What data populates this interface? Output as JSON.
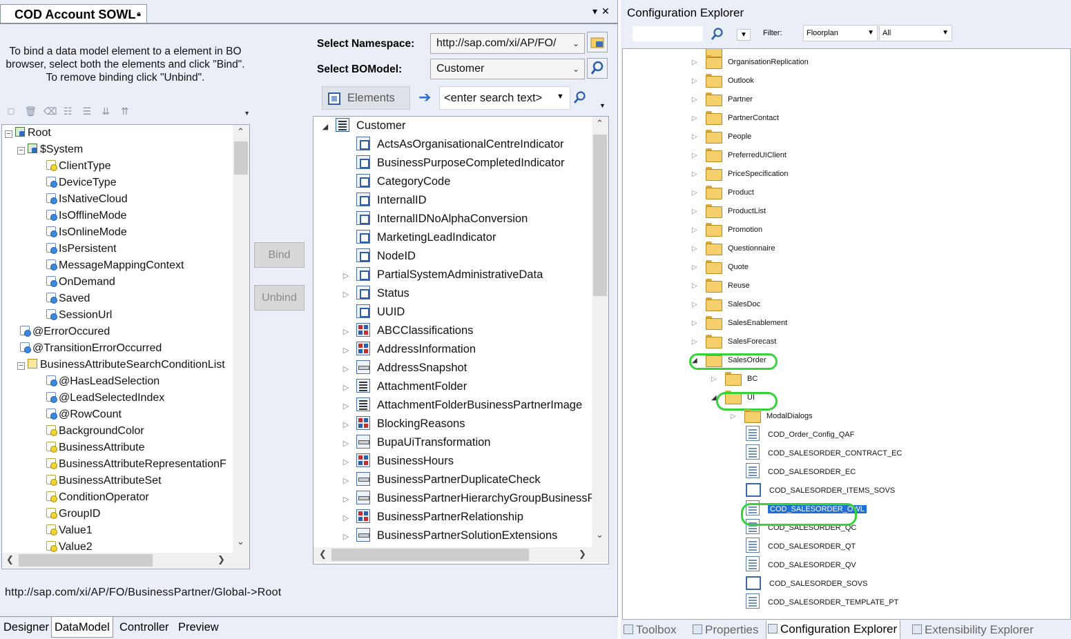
{
  "left_pane": {
    "tab_title": "COD Account SOWL",
    "instructions": "To bind a data model element to a element in BO browser, select both the elements and click \"Bind\". To remove binding click \"Unbind\".",
    "namespace_label": "Select Namespace:",
    "namespace_value": "http://sap.com/xi/AP/FO/",
    "bomodel_label": "Select BOModel:",
    "bomodel_value": "Customer",
    "bind_label": "Bind",
    "unbind_label": "Unbind",
    "elements_label": "Elements",
    "search_placeholder": "<enter search text>",
    "path_text": "http://sap.com/xi/AP/FO/BusinessPartner/Global->Root",
    "bottom_tabs": [
      "Designer",
      "DataModel",
      "Controller",
      "Preview"
    ],
    "active_bottom_tab": "DataModel",
    "datamodel_tree": [
      {
        "label": "Root",
        "level": 0,
        "icon": "root",
        "expander": "-"
      },
      {
        "label": "$System",
        "level": 1,
        "icon": "root",
        "expander": "-"
      },
      {
        "label": "ClientType",
        "level": 2,
        "icon": "attr-y"
      },
      {
        "label": "DeviceType",
        "level": 2,
        "icon": "attr-b"
      },
      {
        "label": "IsNativeCloud",
        "level": 2,
        "icon": "attr-b"
      },
      {
        "label": "IsOfflineMode",
        "level": 2,
        "icon": "attr-b"
      },
      {
        "label": "IsOnlineMode",
        "level": 2,
        "icon": "attr-b"
      },
      {
        "label": "IsPersistent",
        "level": 2,
        "icon": "attr-b"
      },
      {
        "label": "MessageMappingContext",
        "level": 2,
        "icon": "attr-b"
      },
      {
        "label": "OnDemand",
        "level": 2,
        "icon": "attr-b"
      },
      {
        "label": "Saved",
        "level": 2,
        "icon": "attr-b"
      },
      {
        "label": "SessionUrl",
        "level": 2,
        "icon": "attr-b"
      },
      {
        "label": "@ErrorOccured",
        "level": 1,
        "icon": "attr-b"
      },
      {
        "label": "@TransitionErrorOccurred",
        "level": 1,
        "icon": "attr-b"
      },
      {
        "label": "BusinessAttributeSearchConditionList",
        "level": 1,
        "icon": "list",
        "expander": "-"
      },
      {
        "label": "@HasLeadSelection",
        "level": 2,
        "icon": "attr-b"
      },
      {
        "label": "@LeadSelectedIndex",
        "level": 2,
        "icon": "attr-b"
      },
      {
        "label": "@RowCount",
        "level": 2,
        "icon": "attr-b"
      },
      {
        "label": "BackgroundColor",
        "level": 2,
        "icon": "attr-y"
      },
      {
        "label": "BusinessAttribute",
        "level": 2,
        "icon": "attr-y"
      },
      {
        "label": "BusinessAttributeRepresentationF",
        "level": 2,
        "icon": "attr-y"
      },
      {
        "label": "BusinessAttributeSet",
        "level": 2,
        "icon": "attr-y"
      },
      {
        "label": "ConditionOperator",
        "level": 2,
        "icon": "attr-y"
      },
      {
        "label": "GroupID",
        "level": 2,
        "icon": "attr-y"
      },
      {
        "label": "Value1",
        "level": 2,
        "icon": "attr-y"
      },
      {
        "label": "Value2",
        "level": 2,
        "icon": "attr-y"
      }
    ],
    "bo_tree_root": "Customer",
    "bo_tree": [
      {
        "label": "ActsAsOrganisationalCentreIndicator",
        "icon": "attr",
        "expandable": false
      },
      {
        "label": "BusinessPurposeCompletedIndicator",
        "icon": "attr",
        "expandable": false
      },
      {
        "label": "CategoryCode",
        "icon": "attr",
        "expandable": false
      },
      {
        "label": "InternalID",
        "icon": "attr",
        "expandable": false
      },
      {
        "label": "InternalIDNoAlphaConversion",
        "icon": "attr",
        "expandable": false
      },
      {
        "label": "MarketingLeadIndicator",
        "icon": "attr",
        "expandable": false
      },
      {
        "label": "NodeID",
        "icon": "attr",
        "expandable": false
      },
      {
        "label": "PartialSystemAdministrativeData",
        "icon": "attr",
        "expandable": true
      },
      {
        "label": "Status",
        "icon": "attr",
        "expandable": true
      },
      {
        "label": "UUID",
        "icon": "attr",
        "expandable": false
      },
      {
        "label": "ABCClassifications",
        "icon": "assoc-red",
        "expandable": true
      },
      {
        "label": "AddressInformation",
        "icon": "assoc-red",
        "expandable": true
      },
      {
        "label": "AddressSnapshot",
        "icon": "assoc",
        "expandable": true
      },
      {
        "label": "AttachmentFolder",
        "icon": "list",
        "expandable": true
      },
      {
        "label": "AttachmentFolderBusinessPartnerImage",
        "icon": "list",
        "expandable": true
      },
      {
        "label": "BlockingReasons",
        "icon": "assoc-red",
        "expandable": true
      },
      {
        "label": "BupaUiTransformation",
        "icon": "assoc",
        "expandable": true
      },
      {
        "label": "BusinessHours",
        "icon": "assoc-red",
        "expandable": true
      },
      {
        "label": "BusinessPartnerDuplicateCheck",
        "icon": "assoc",
        "expandable": true
      },
      {
        "label": "BusinessPartnerHierarchyGroupBusinessPa",
        "icon": "assoc",
        "expandable": true
      },
      {
        "label": "BusinessPartnerRelationship",
        "icon": "assoc-red",
        "expandable": true
      },
      {
        "label": "BusinessPartnerSolutionExtensions",
        "icon": "assoc",
        "expandable": true
      }
    ]
  },
  "right_pane": {
    "title": "Configuration Explorer",
    "filter_label": "Filter:",
    "filter_value": "Floorplan",
    "filter_scope": "All",
    "folders": [
      "OrganisationReplication",
      "Outlook",
      "Partner",
      "PartnerContact",
      "People",
      "PreferredUIClient",
      "PriceSpecification",
      "Product",
      "ProductList",
      "Promotion",
      "Questionnaire",
      "Quote",
      "Reuse",
      "SalesDoc",
      "SalesEnablement",
      "SalesForecast"
    ],
    "salesorder_label": "SalesOrder",
    "bc_label": "BC",
    "ui_label": "UI",
    "modal_label": "ModalDialogs",
    "ui_files": [
      "COD_Order_Config_QAF",
      "COD_SALESORDER_CONTRACT_EC",
      "COD_SALESORDER_EC",
      "COD_SALESORDER_ITEMS_SOVS",
      "COD_SALESORDER_OWL",
      "COD_SALESORDER_QC",
      "COD_SALESORDER_QT",
      "COD_SALESORDER_QV",
      "COD_SALESORDER_SOVS",
      "COD_SALESORDER_TEMPLATE_PT"
    ],
    "selected_file": "COD_SALESORDER_OWL",
    "bottom_tabs": [
      "Toolbox",
      "Properties",
      "Configuration Explorer",
      "Extensibility Explorer"
    ],
    "active_bottom_tab": "Configuration Explorer"
  },
  "colors": {
    "highlight_green": "#35d335",
    "selection_blue": "#1f6fd6"
  }
}
